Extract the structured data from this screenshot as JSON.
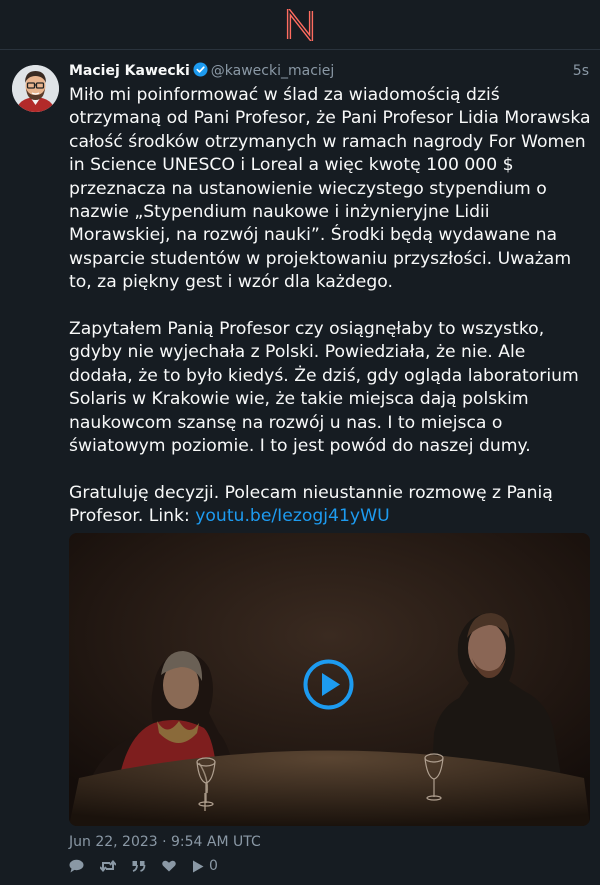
{
  "tweet": {
    "fullname": "Maciej Kawecki",
    "username": "@kawecki_maciej",
    "time": "5s",
    "paragraphs": [
      "Miło mi poinformować w ślad za wiadomością dziś otrzymaną od Pani Profesor, że Pani Profesor Lidia Morawska całość środków otrzymanych w ramach nagrody For Women in Science UNESCO i Loreal a więc kwotę 100 000 $ przeznacza na ustanowienie wieczystego stypendium o nazwie „Stypendium naukowe i inżynieryjne Lidii Morawskiej, na rozwój nauki”. Środki będą wydawane na wsparcie studentów w projektowaniu przyszłości. Uważam to, za piękny gest i wzór dla każdego.",
      "Zapytałem Panią Profesor czy osiągnęłaby to wszystko, gdyby nie wyjechała z Polski. Powiedziała, że nie. Ale dodała, że to było kiedyś. Że dziś, gdy ogląda laboratorium Solaris w Krakowie wie, że takie miejsca dają polskim naukowcom szansę na rozwój u nas. I to miejsca o światowym poziomie. I to jest powód do naszej dumy."
    ],
    "closing_text": "Gratuluję decyzji. Polecam nieustannie rozmowę z Panią Profesor. Link: ",
    "link_text": "youtu.be/Iezogj41yWU",
    "date": "Jun 22, 2023 · 9:54 AM UTC",
    "stats": {
      "replies": "",
      "retweets": "",
      "quotes": "",
      "likes": "",
      "plays": "0"
    }
  },
  "colors": {
    "background": "#0f1419",
    "panel": "#161c22",
    "text": "#f8f9f9",
    "muted": "#8a98a5",
    "accent": "#1d9bf0",
    "logo": "#ff6c60"
  },
  "icons": {
    "logo": "nitter-logo",
    "verified": "verified-badge-icon",
    "reply": "comment-icon",
    "retweet": "retweet-icon",
    "quote": "quote-icon",
    "like": "heart-icon",
    "play": "play-icon"
  }
}
